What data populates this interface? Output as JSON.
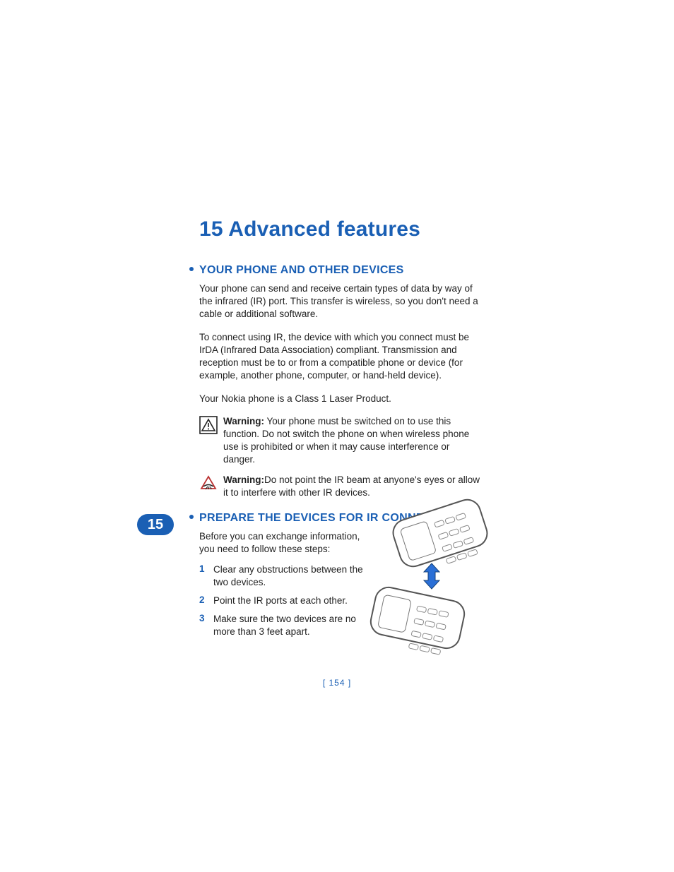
{
  "chapter": {
    "number": "15",
    "title": "Advanced features"
  },
  "tab": "15",
  "pageNumber": "[ 154 ]",
  "section1": {
    "heading": "YOUR PHONE AND OTHER DEVICES",
    "p1": "Your phone can send and receive certain types of data by way of the infrared (IR) port. This transfer is wireless, so you don't need a cable or additional software.",
    "p2": "To connect using IR, the device with which you connect must be IrDA (Infrared Data Association) compliant. Transmission and reception must be to or from a compatible phone or device (for example, another phone, computer, or hand-held device).",
    "p3": "Your Nokia phone is a Class 1 Laser Product.",
    "warning1": {
      "label": "Warning:",
      "text": "  Your phone must be switched on to use this function. Do not switch the phone on when wireless phone use is prohibited or when it may cause interference or danger."
    },
    "warning2": {
      "label": "Warning:",
      "text": "Do not point the IR beam at anyone's eyes or allow it to interfere with other IR devices."
    }
  },
  "section2": {
    "heading": "PREPARE THE DEVICES FOR IR CONNECTION",
    "intro": "Before you can exchange information, you need to follow these steps:",
    "steps": [
      {
        "n": "1",
        "t": "Clear any obstructions between the two devices."
      },
      {
        "n": "2",
        "t": "Point the IR ports at each other."
      },
      {
        "n": "3",
        "t": "Make sure the two devices are no more than 3 feet apart."
      }
    ]
  }
}
